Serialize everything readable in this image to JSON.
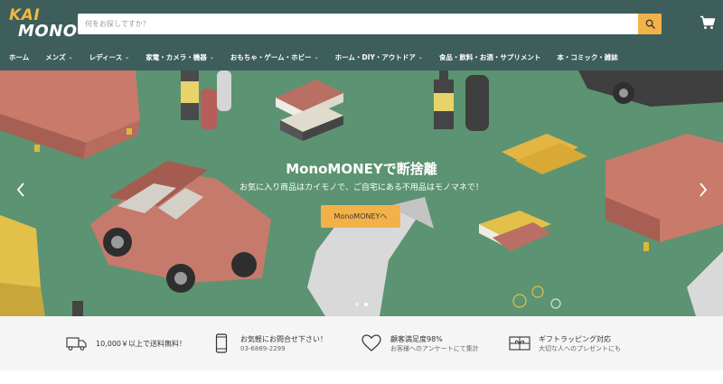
{
  "header": {
    "logo_line1": "KAI",
    "logo_line2": "MONO",
    "search_placeholder": "何をお探しですか？"
  },
  "nav": {
    "items": [
      {
        "label": "ホーム",
        "dropdown": false
      },
      {
        "label": "メンズ",
        "dropdown": true
      },
      {
        "label": "レディース",
        "dropdown": true
      },
      {
        "label": "家電・カメラ・機器",
        "dropdown": true
      },
      {
        "label": "おもちゃ・ゲーム・ホビー",
        "dropdown": true
      },
      {
        "label": "ホーム・DIY・アウトドア",
        "dropdown": true
      },
      {
        "label": "食品・飲料・お酒・サプリメント",
        "dropdown": false
      },
      {
        "label": "本・コミック・雑誌",
        "dropdown": false
      }
    ]
  },
  "hero": {
    "title": "MonoMONEYで断捨離",
    "subtitle": "お気に入り商品はカイモノで、ご自宅にある不用品はモノマネで！",
    "cta": "MonoMONEYへ",
    "slide_count": 2,
    "active_slide": 2
  },
  "features": [
    {
      "icon": "truck-icon",
      "title": "10,000￥以上で送料無料！",
      "sub": ""
    },
    {
      "icon": "phone-icon",
      "title": "お気軽にお問合せ下さい！",
      "sub": "03-6869-2299"
    },
    {
      "icon": "heart-icon",
      "title": "顧客満足度98%",
      "sub": "お客様へのアンケートにて集計"
    },
    {
      "icon": "gift-icon",
      "title": "ギフトラッピング対応",
      "sub": "大切な人へのプレゼントにも"
    }
  ],
  "colors": {
    "header_bg": "#3d5e5a",
    "accent": "#f3b14a",
    "hero_bg": "#5c9372",
    "features_bg": "#f5f5f5"
  }
}
